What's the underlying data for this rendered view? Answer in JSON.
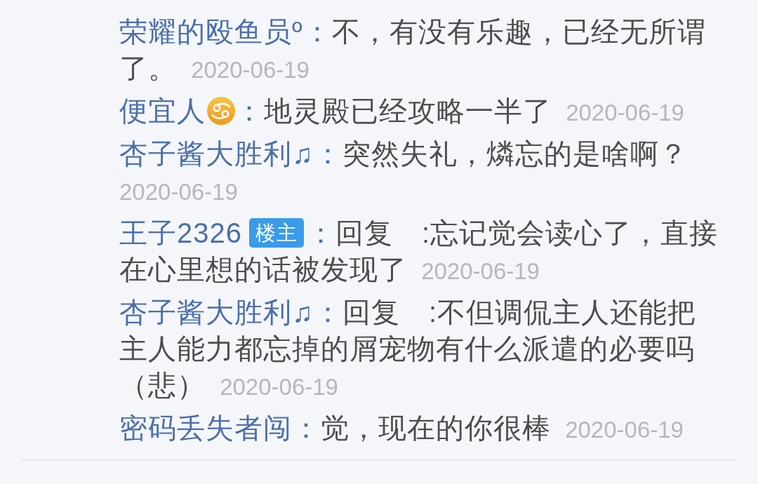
{
  "replies": [
    {
      "username": "荣耀的殴鱼员º",
      "user_icon": false,
      "separator": "：",
      "text": "不，有没有乐趣，已经无所谓了。",
      "date": "2020-06-19"
    },
    {
      "username": "便宜人",
      "user_icon": true,
      "separator": "：",
      "text": "地灵殿已经攻略一半了",
      "date": "2020-06-19"
    },
    {
      "username": "杏子酱大胜利♫",
      "user_icon": false,
      "separator": "：",
      "text": "突然失礼，燐忘的是啥啊？",
      "date": "2020-06-19"
    },
    {
      "username": "王子2326",
      "user_icon": false,
      "badge": "楼主",
      "separator": "：",
      "text": "回复　:忘记觉会读心了，直接在心里想的话被发现了",
      "date": "2020-06-19"
    },
    {
      "username": "杏子酱大胜利♫",
      "user_icon": false,
      "separator": "：",
      "text": "回复　:不但调侃主人还能把主人能力都忘掉的屑宠物有什么派遣的必要吗（悲）",
      "date": "2020-06-19"
    },
    {
      "username": "密码丢失者闯",
      "user_icon": false,
      "separator": "：",
      "text": "觉，现在的你很棒",
      "date": "2020-06-19"
    }
  ]
}
